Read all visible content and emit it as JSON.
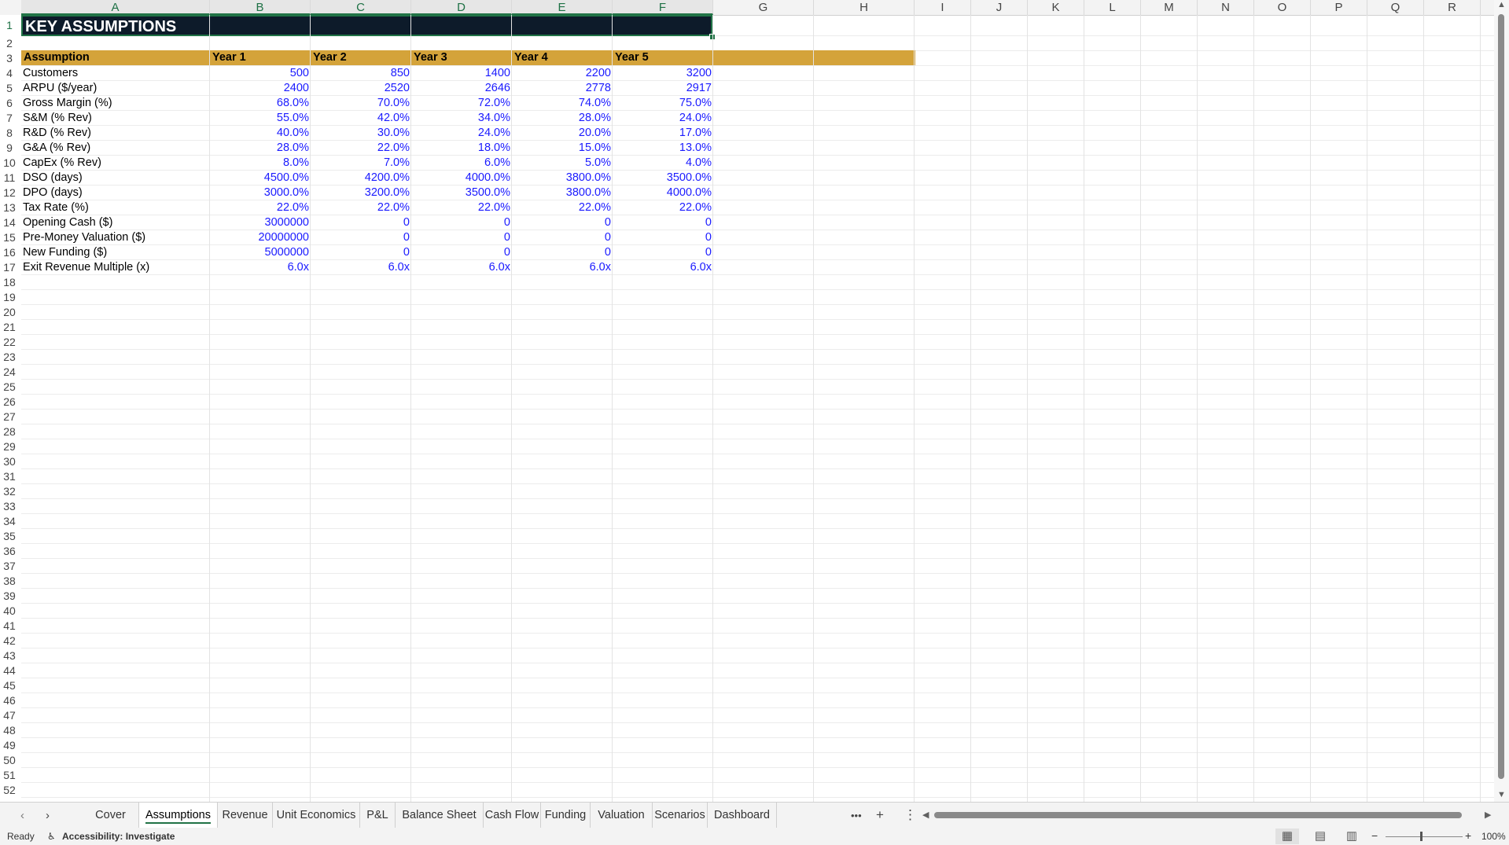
{
  "columns": [
    "A",
    "B",
    "C",
    "D",
    "E",
    "F",
    "G",
    "H",
    "I",
    "J",
    "K",
    "L",
    "M",
    "N",
    "O",
    "P",
    "Q",
    "R"
  ],
  "row_numbers": [
    "1",
    "2",
    "3",
    "4",
    "5",
    "6",
    "7",
    "8",
    "9",
    "10",
    "11",
    "12",
    "13",
    "14",
    "15",
    "16",
    "17",
    "18",
    "19",
    "20",
    "21",
    "22",
    "23",
    "24",
    "25",
    "26",
    "27",
    "28",
    "29",
    "30",
    "31",
    "32",
    "33",
    "34",
    "35",
    "36",
    "37",
    "38",
    "39",
    "40",
    "41",
    "42",
    "43",
    "44",
    "45",
    "46",
    "47",
    "48",
    "49",
    "50",
    "51",
    "52"
  ],
  "sheet": {
    "title": "KEY ASSUMPTIONS",
    "header": [
      "Assumption",
      "Year 1",
      "Year 2",
      "Year 3",
      "Year 4",
      "Year 5"
    ],
    "rows": [
      {
        "label": "Customers",
        "values": [
          "500",
          "850",
          "1400",
          "2200",
          "3200"
        ]
      },
      {
        "label": "ARPU ($/year)",
        "values": [
          "2400",
          "2520",
          "2646",
          "2778",
          "2917"
        ]
      },
      {
        "label": "Gross Margin (%)",
        "values": [
          "68.0%",
          "70.0%",
          "72.0%",
          "74.0%",
          "75.0%"
        ]
      },
      {
        "label": "S&M (% Rev)",
        "values": [
          "55.0%",
          "42.0%",
          "34.0%",
          "28.0%",
          "24.0%"
        ]
      },
      {
        "label": "R&D (% Rev)",
        "values": [
          "40.0%",
          "30.0%",
          "24.0%",
          "20.0%",
          "17.0%"
        ]
      },
      {
        "label": "G&A (% Rev)",
        "values": [
          "28.0%",
          "22.0%",
          "18.0%",
          "15.0%",
          "13.0%"
        ]
      },
      {
        "label": "CapEx (% Rev)",
        "values": [
          "8.0%",
          "7.0%",
          "6.0%",
          "5.0%",
          "4.0%"
        ]
      },
      {
        "label": "DSO (days)",
        "values": [
          "4500.0%",
          "4200.0%",
          "4000.0%",
          "3800.0%",
          "3500.0%"
        ]
      },
      {
        "label": "DPO (days)",
        "values": [
          "3000.0%",
          "3200.0%",
          "3500.0%",
          "3800.0%",
          "4000.0%"
        ]
      },
      {
        "label": "Tax Rate (%)",
        "values": [
          "22.0%",
          "22.0%",
          "22.0%",
          "22.0%",
          "22.0%"
        ]
      },
      {
        "label": "Opening Cash ($)",
        "values": [
          "3000000",
          "0",
          "0",
          "0",
          "0"
        ]
      },
      {
        "label": "Pre-Money Valuation ($)",
        "values": [
          "20000000",
          "0",
          "0",
          "0",
          "0"
        ]
      },
      {
        "label": "New Funding ($)",
        "values": [
          "5000000",
          "0",
          "0",
          "0",
          "0"
        ]
      },
      {
        "label": "Exit Revenue Multiple (x)",
        "values": [
          "6.0x",
          "6.0x",
          "6.0x",
          "6.0x",
          "6.0x"
        ]
      }
    ]
  },
  "tabs": [
    "Cover",
    "Assumptions",
    "Revenue",
    "Unit Economics",
    "P&L",
    "Balance Sheet",
    "Cash Flow",
    "Funding",
    "Valuation",
    "Scenarios",
    "Dashboard"
  ],
  "active_tab": "Assumptions",
  "tab_icons": {
    "more": "•••",
    "add": "+",
    "options": "⋮",
    "prev": "‹",
    "next": "›"
  },
  "status": {
    "ready": "Ready",
    "accessibility": "Accessibility: Investigate",
    "zoom": "100%"
  },
  "colors": {
    "title_bg": "#0d1b2a",
    "header_bg": "#d4a33a",
    "input_blue": "#1a1aff",
    "excel_green": "#217346"
  }
}
